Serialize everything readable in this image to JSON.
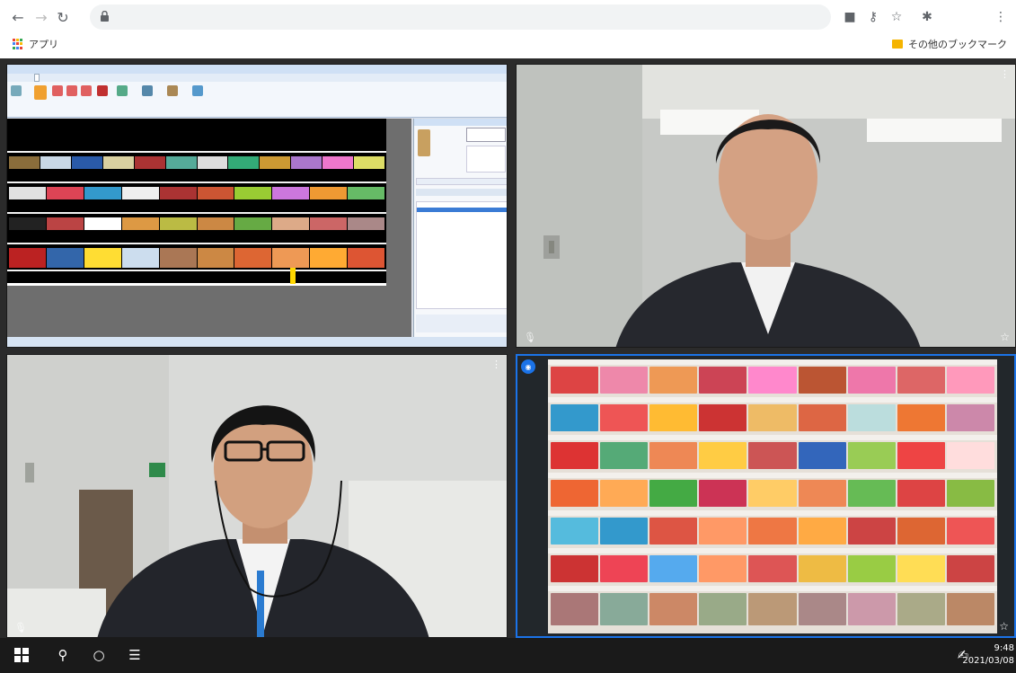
{
  "browser": {
    "bookmarks_apps_label": "アプリ",
    "other_bookmarks_label": "その他のブックマーク",
    "icons": [
      "back-icon",
      "forward-icon",
      "reload-icon",
      "lock-icon",
      "camera-icon",
      "key-icon",
      "star-icon",
      "extensions-icon",
      "menu-icon"
    ]
  },
  "call": {
    "tiles": [
      {
        "name": "screen-share-tile",
        "kind": "shared-screen"
      },
      {
        "name": "participant-tile-1",
        "kind": "camera"
      },
      {
        "name": "participant-tile-2",
        "kind": "camera"
      },
      {
        "name": "store-shelf-tile",
        "kind": "camera",
        "active_speaker": true
      }
    ],
    "accent": "#1b73e8"
  },
  "taskbar": {
    "time": "9:48",
    "date": "2021/03/08"
  }
}
